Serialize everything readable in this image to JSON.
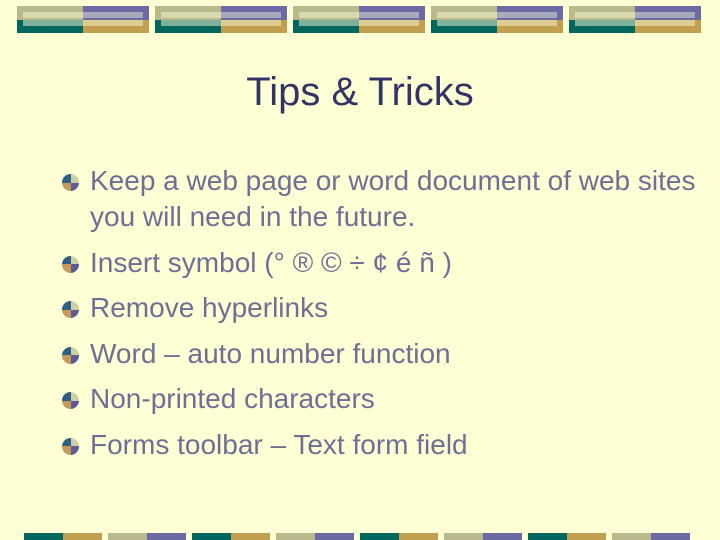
{
  "slide": {
    "title": "Tips & Tricks",
    "bullets": [
      {
        "text": "Keep a web page or word document of web sites you will need in the future.",
        "icon": "quartered-circle-bullet-icon"
      },
      {
        "text": "Insert symbol (° ® © ÷ ¢ é ñ )",
        "icon": "quartered-circle-bullet-icon"
      },
      {
        "text": "Remove hyperlinks",
        "icon": "quartered-circle-bullet-icon"
      },
      {
        "text": "Word – auto number function",
        "icon": "quartered-circle-bullet-icon"
      },
      {
        "text": "Non-printed characters",
        "icon": "quartered-circle-bullet-icon"
      },
      {
        "text": "Forms toolbar – Text form field",
        "icon": "quartered-circle-bullet-icon"
      }
    ]
  },
  "theme": {
    "background": "#ffffd6",
    "title_color": "#333366",
    "text_color": "#6f6e95",
    "accent_teal": "#00675f",
    "accent_gold": "#c29f4e",
    "accent_khaki": "#b9b98c",
    "accent_purple": "#6b6aa2"
  }
}
